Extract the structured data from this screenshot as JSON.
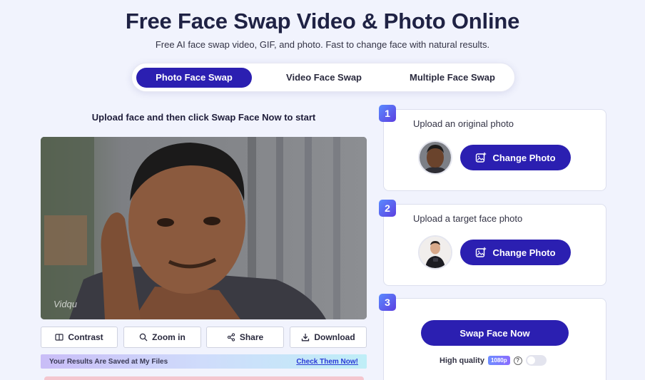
{
  "header": {
    "title": "Free Face Swap Video & Photo Online",
    "subtitle": "Free AI face swap video, GIF, and photo. Fast to change face with natural results."
  },
  "tabs": [
    {
      "label": "Photo Face Swap",
      "active": true
    },
    {
      "label": "Video Face Swap",
      "active": false
    },
    {
      "label": "Multiple Face Swap",
      "active": false
    }
  ],
  "main": {
    "hint": "Upload face and then click Swap Face Now to start",
    "watermark": "Vidqu",
    "actions": {
      "contrast": "Contrast",
      "zoom_in": "Zoom in",
      "share": "Share",
      "download": "Download"
    },
    "saved_notice": {
      "text": "Your Results Are Saved at My Files",
      "link": "Check Them Now!"
    }
  },
  "steps": [
    {
      "number": "1",
      "label": "Upload an original photo",
      "button": "Change Photo"
    },
    {
      "number": "2",
      "label": "Upload a target face photo",
      "button": "Change Photo"
    },
    {
      "number": "3",
      "button": "Swap Face Now",
      "quality_label": "High quality",
      "quality_badge": "1080p",
      "help": "?",
      "toggle_on": false
    }
  ],
  "colors": {
    "primary": "#2b1fb1",
    "background": "#f1f3fd"
  }
}
